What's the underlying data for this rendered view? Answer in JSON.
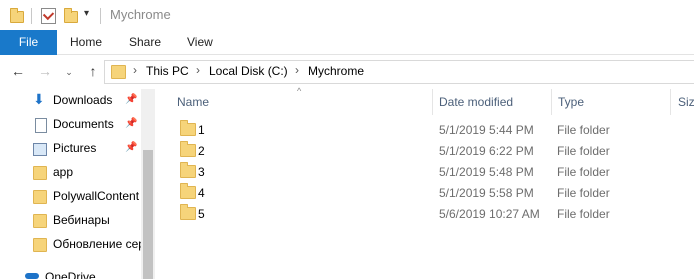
{
  "window": {
    "title": "Mychrome"
  },
  "ribbon": {
    "tabs": [
      {
        "label": "File"
      },
      {
        "label": "Home"
      },
      {
        "label": "Share"
      },
      {
        "label": "View"
      }
    ]
  },
  "address": {
    "crumbs": [
      "This PC",
      "Local Disk (C:)",
      "Mychrome"
    ]
  },
  "nav": {
    "items": [
      {
        "label": "Downloads",
        "icon": "download-arrow-icon",
        "pinned": true
      },
      {
        "label": "Documents",
        "icon": "document-icon",
        "pinned": true
      },
      {
        "label": "Pictures",
        "icon": "pictures-icon",
        "pinned": true
      },
      {
        "label": "app",
        "icon": "folder-icon",
        "pinned": false
      },
      {
        "label": "PolywallContent",
        "icon": "folder-icon",
        "pinned": false
      },
      {
        "label": "Вебинары",
        "icon": "folder-icon",
        "pinned": false
      },
      {
        "label": "Обновление сер",
        "icon": "folder-icon",
        "pinned": false
      },
      {
        "label": "OneDrive",
        "icon": "onedrive-cloud-icon",
        "pinned": false
      }
    ]
  },
  "list": {
    "columns": [
      "Name",
      "Date modified",
      "Type",
      "Size"
    ],
    "rows": [
      {
        "name": "1",
        "date": "5/1/2019 5:44 PM",
        "type": "File folder"
      },
      {
        "name": "2",
        "date": "5/1/2019 6:22 PM",
        "type": "File folder"
      },
      {
        "name": "3",
        "date": "5/1/2019 5:48 PM",
        "type": "File folder"
      },
      {
        "name": "4",
        "date": "5/1/2019 5:58 PM",
        "type": "File folder"
      },
      {
        "name": "5",
        "date": "5/6/2019 10:27 AM",
        "type": "File folder"
      }
    ]
  }
}
